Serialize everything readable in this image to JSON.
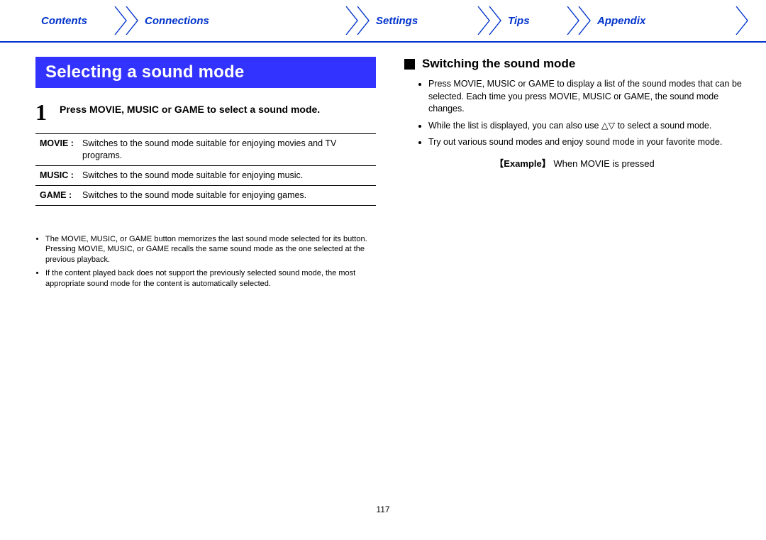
{
  "nav": {
    "items": [
      "Contents",
      "Connections",
      "Settings",
      "Tips",
      "Appendix"
    ]
  },
  "left": {
    "banner": "Selecting a sound mode",
    "step_num": "1",
    "step_text": "Press MOVIE, MUSIC or GAME to select a sound mode.",
    "modes": [
      {
        "label": "MOVIE :",
        "desc": "Switches to the sound mode suitable for enjoying movies and TV programs."
      },
      {
        "label": "MUSIC :",
        "desc": "Switches to the sound mode suitable for enjoying music."
      },
      {
        "label": "GAME :",
        "desc": "Switches to the sound mode suitable for enjoying games."
      }
    ],
    "notes": [
      "The MOVIE, MUSIC, or GAME button memorizes the last sound mode selected for its button. Pressing MOVIE, MUSIC, or GAME recalls the same sound mode as the one selected at the previous playback.",
      "If the content played back does not support the previously selected sound mode, the most appropriate sound mode for the content is automatically selected."
    ]
  },
  "right": {
    "heading": "Switching the sound mode",
    "bullets": [
      "Press MOVIE, MUSIC or GAME to display a list of the sound modes that can be selected. Each time you press MOVIE, MUSIC or GAME, the sound mode changes.",
      "While the list is displayed, you can also use △▽ to select a sound mode.",
      "Try out various sound modes and enjoy sound mode in your favorite mode."
    ],
    "example_label": "【Example】",
    "example_text": "When MOVIE is pressed"
  },
  "page_number": "117"
}
